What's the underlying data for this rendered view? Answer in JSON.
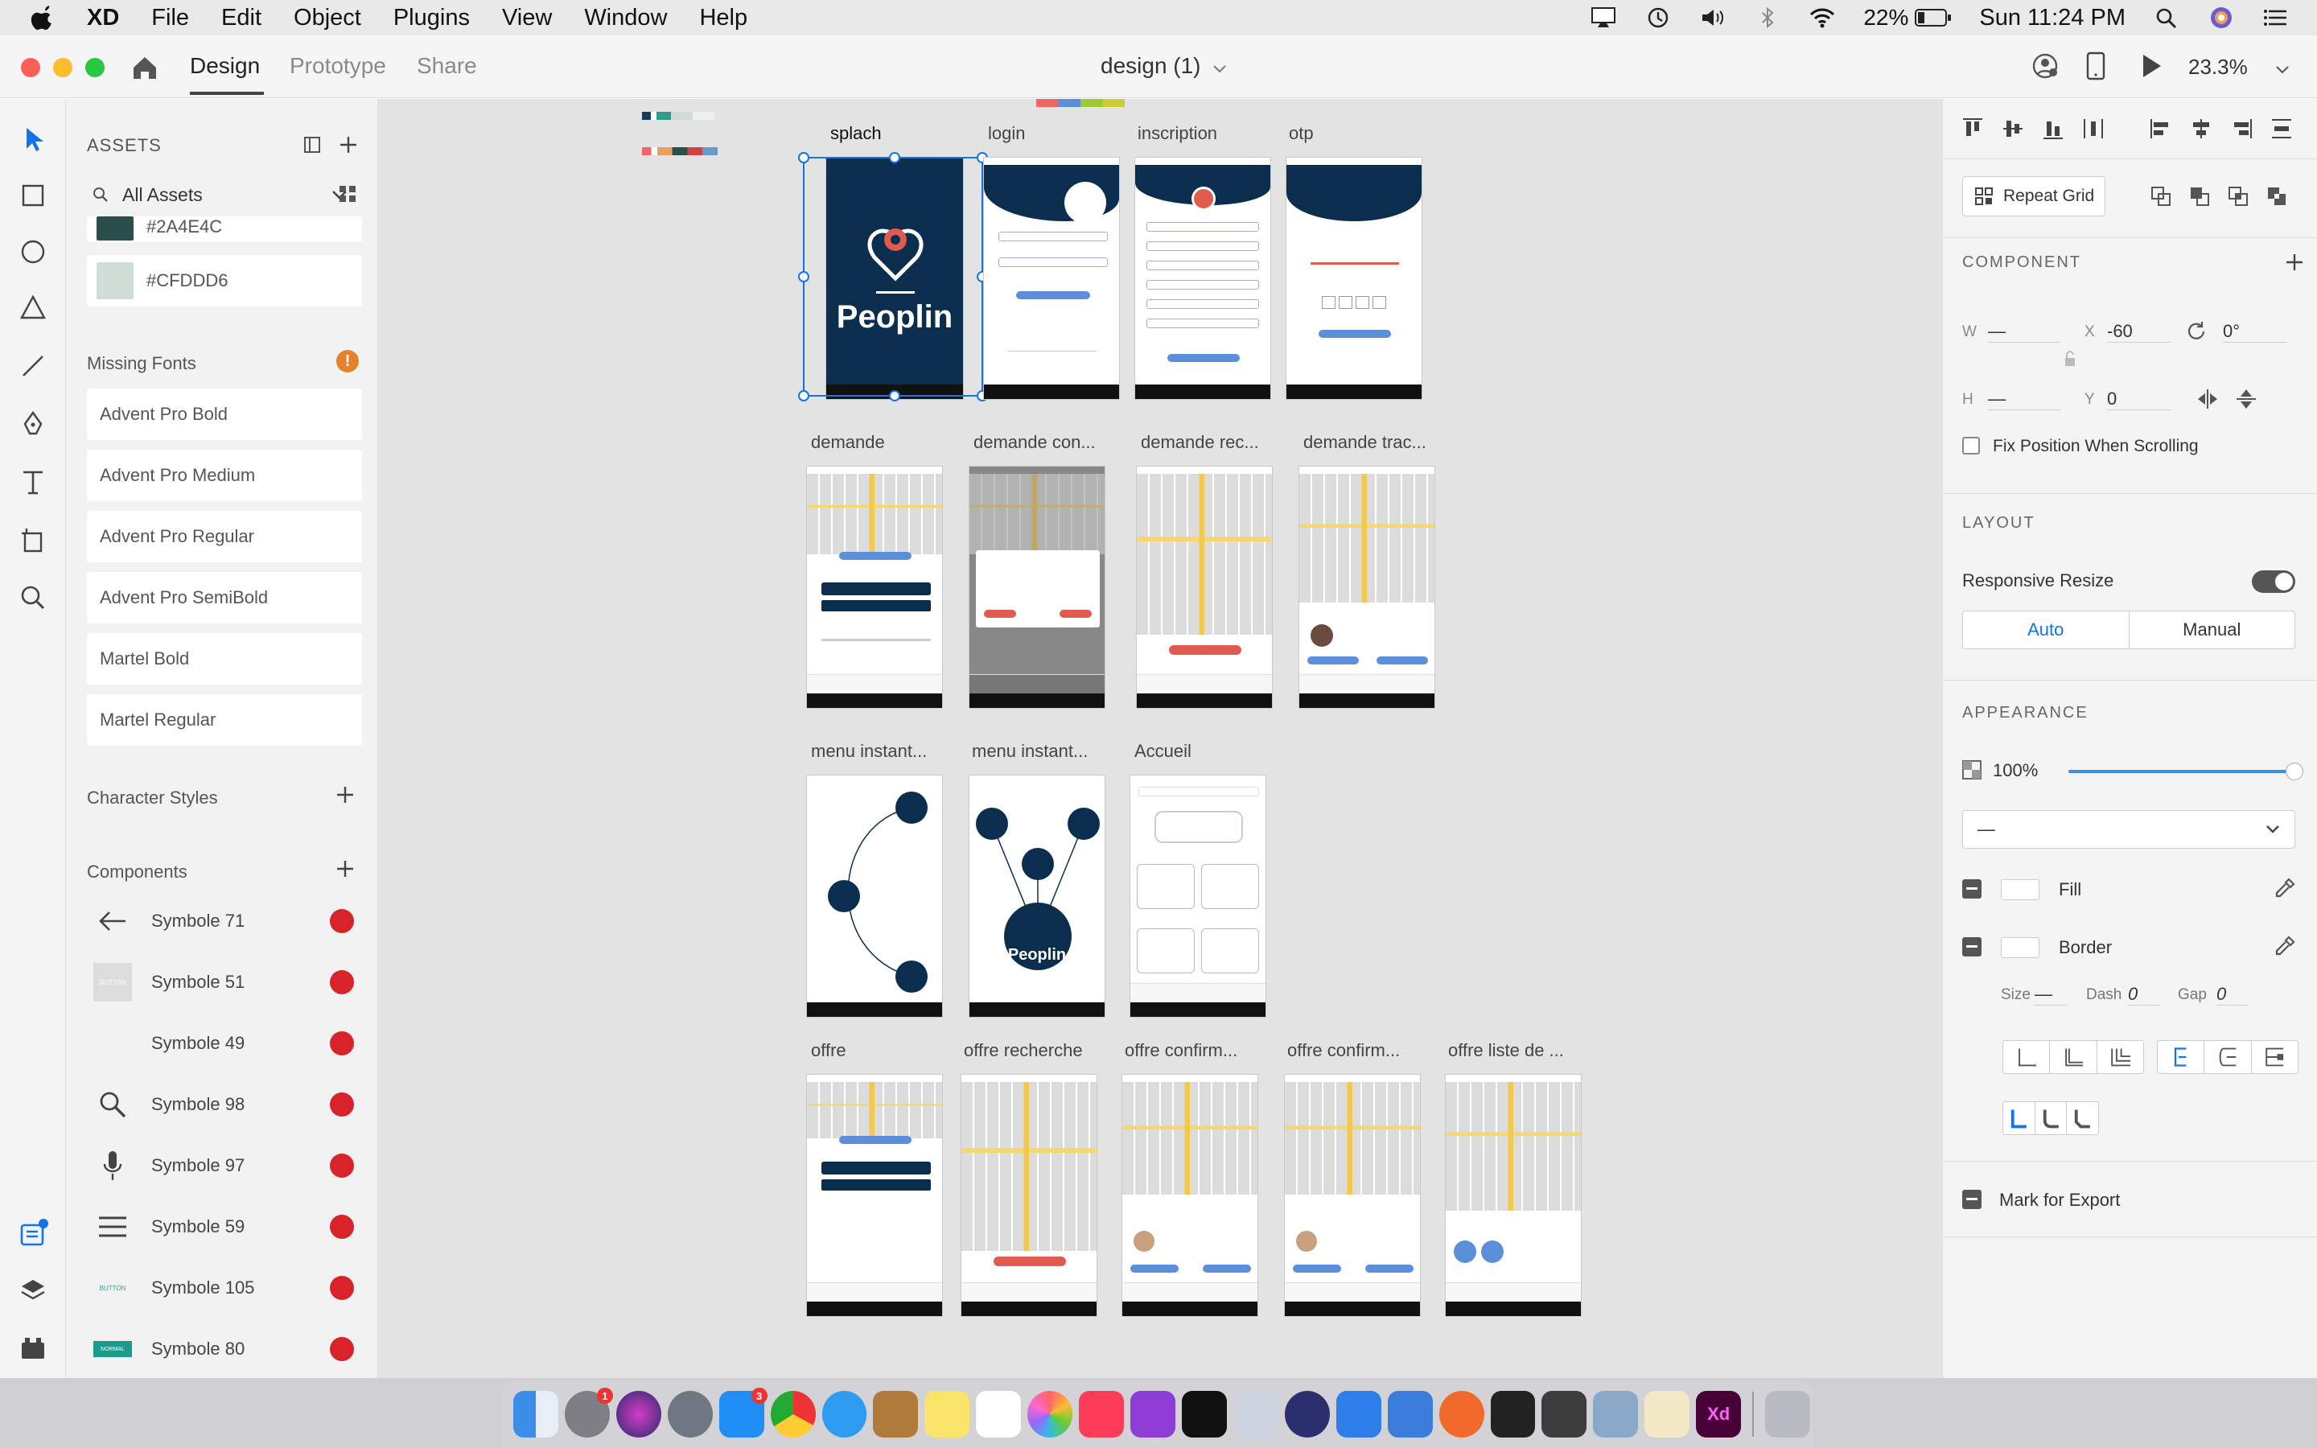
{
  "menubar": {
    "app": "XD",
    "items": [
      "File",
      "Edit",
      "Object",
      "Plugins",
      "View",
      "Window",
      "Help"
    ],
    "battery": "22%",
    "clock": "Sun 11:24 PM"
  },
  "titlebar": {
    "tabs": [
      "Design",
      "Prototype",
      "Share"
    ],
    "document": "design (1)",
    "zoom": "23.3%"
  },
  "assets": {
    "title": "ASSETS",
    "filter": "All Assets",
    "colors": [
      {
        "hex": "#2A4E4C",
        "value": "#2A4E4C"
      },
      {
        "hex": "#CFDDD6",
        "value": "#CFDDD6"
      }
    ],
    "missing_fonts_title": "Missing Fonts",
    "fonts": [
      "Advent Pro Bold",
      "Advent Pro Medium",
      "Advent Pro Regular",
      "Advent Pro SemiBold",
      "Martel Bold",
      "Martel Regular"
    ],
    "char_styles_title": "Character Styles",
    "components_title": "Components",
    "components": [
      {
        "name": "Symbole 71",
        "icon": "arrow-left-icon"
      },
      {
        "name": "Symbole 51",
        "icon": "button-thumb",
        "thumb": "BUTTON"
      },
      {
        "name": "Symbole 49",
        "icon": "blank"
      },
      {
        "name": "Symbole 98",
        "icon": "search-icon"
      },
      {
        "name": "Symbole 97",
        "icon": "microphone-icon"
      },
      {
        "name": "Symbole 59",
        "icon": "hamburger-icon"
      },
      {
        "name": "Symbole 105",
        "icon": "button-thumb",
        "thumb": "BUTTON"
      },
      {
        "name": "Symbole 80",
        "icon": "normal-thumb",
        "thumb": "NORMAL"
      }
    ]
  },
  "canvas": {
    "artboards": [
      {
        "label": "splach"
      },
      {
        "label": "login"
      },
      {
        "label": "inscription"
      },
      {
        "label": "otp"
      },
      {
        "label": "demande"
      },
      {
        "label": "demande con..."
      },
      {
        "label": "demande rec..."
      },
      {
        "label": "demande trac..."
      },
      {
        "label": "menu instant..."
      },
      {
        "label": "menu instant..."
      },
      {
        "label": "Accueil"
      },
      {
        "label": "offre"
      },
      {
        "label": "offre recherche"
      },
      {
        "label": "offre confirm..."
      },
      {
        "label": "offre confirm..."
      },
      {
        "label": "offre liste de ..."
      }
    ],
    "splash_brand": "Peoplin",
    "menu_brand": "Peoplin"
  },
  "props": {
    "repeat_grid": "Repeat Grid",
    "component_title": "COMPONENT",
    "w_label": "W",
    "w_value": "—",
    "x_label": "X",
    "x_value": "-60",
    "rotation": "0°",
    "h_label": "H",
    "h_value": "—",
    "y_label": "Y",
    "y_value": "0",
    "fix_position": "Fix Position When Scrolling",
    "layout_title": "LAYOUT",
    "responsive_resize": "Responsive Resize",
    "responsive_on": true,
    "auto": "Auto",
    "manual": "Manual",
    "appearance_title": "APPEARANCE",
    "opacity": "100%",
    "blend": "—",
    "fill": "Fill",
    "border": "Border",
    "size_label": "Size",
    "size_value": "—",
    "dash_label": "Dash",
    "dash_value": "0",
    "gap_label": "Gap",
    "gap_value": "0",
    "mark_export": "Mark for Export"
  },
  "dock": {
    "badges": {
      "system_prefs": "1",
      "app_store": "3"
    },
    "xd_label": "Xd"
  }
}
